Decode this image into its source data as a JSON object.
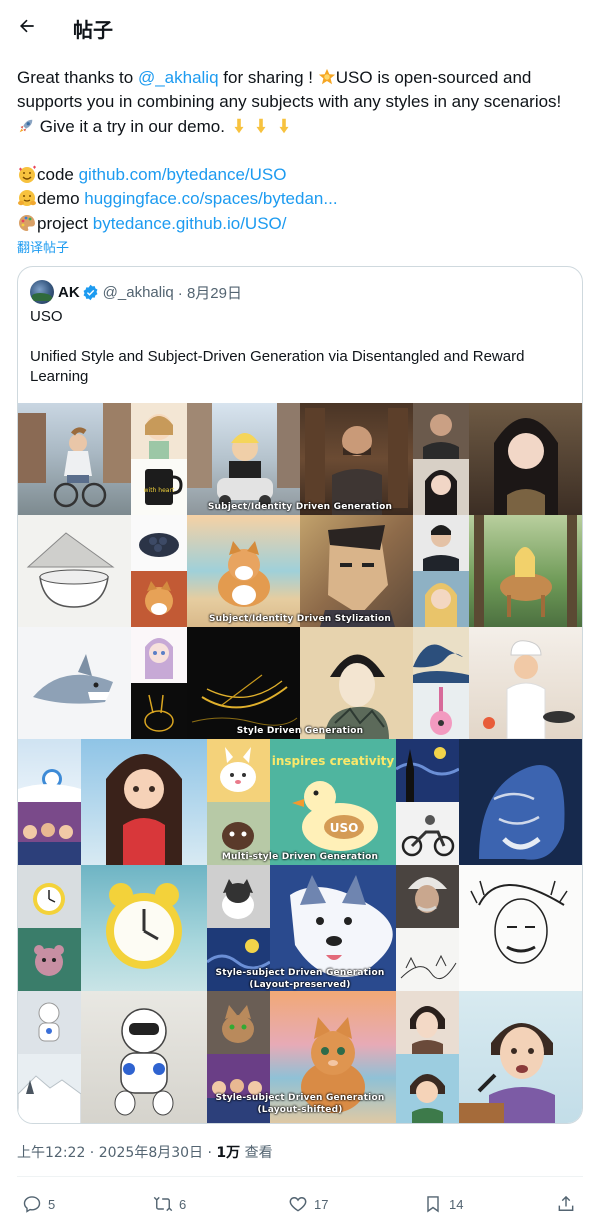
{
  "header": {
    "title": "帖子",
    "back_icon": "arrow-left-icon"
  },
  "post": {
    "text_prefix": "Great thanks to ",
    "mention": "@_akhaliq",
    "text_after_mention": " for sharing ! ",
    "text_uso": "USO is open-sourced and",
    "line2": "supports you in combining any subjects with any styles in any scenarios!",
    "line3": "Give it a try in our demo.",
    "code_label": "code ",
    "code_link": "github.com/bytedance/USO",
    "demo_label": "demo ",
    "demo_link": "huggingface.co/spaces/bytedan...",
    "project_label": "project ",
    "project_link": "bytedance.github.io/USO/",
    "translate": "翻译帖子",
    "emojis": {
      "star": "star-icon",
      "rocket": "rocket-icon",
      "point_down": "pointing-down-icon",
      "hearts": "smiling-face-with-hearts-icon",
      "hug": "hugging-face-icon",
      "palette": "artist-palette-icon"
    }
  },
  "quote": {
    "name": "AK",
    "handle": "@_akhaliq",
    "date": "· 8月29日",
    "title": "USO",
    "subtitle": "Unified Style and Subject-Driven Generation via Disentangled and Reward Learning",
    "captions": {
      "c1": "Subject/Identity Driven Generation",
      "c2": "Subject/Identity Driven Stylization",
      "c3": "Style Driven Generation",
      "c4": "Multi-style Driven Generation",
      "c5a": "Style-subject Driven Generation",
      "c5b": "(Layout-preserved)",
      "c6a": "Style-subject Driven Generation",
      "c6b": "(Layout-shifted)"
    },
    "image_text": {
      "mug": "with heart",
      "duck_headline": "inspires creativity",
      "duck_name": "USO"
    }
  },
  "meta": {
    "time": "上午12:22 · 2025年8月30日 · ",
    "views_count": "1万",
    "views_label": " 查看"
  },
  "actions": {
    "reply": "5",
    "repost": "6",
    "like": "17",
    "bookmark": "14"
  },
  "colors": {
    "link": "#1d9bf0",
    "secondary": "#536471",
    "border": "#cfd9de"
  }
}
